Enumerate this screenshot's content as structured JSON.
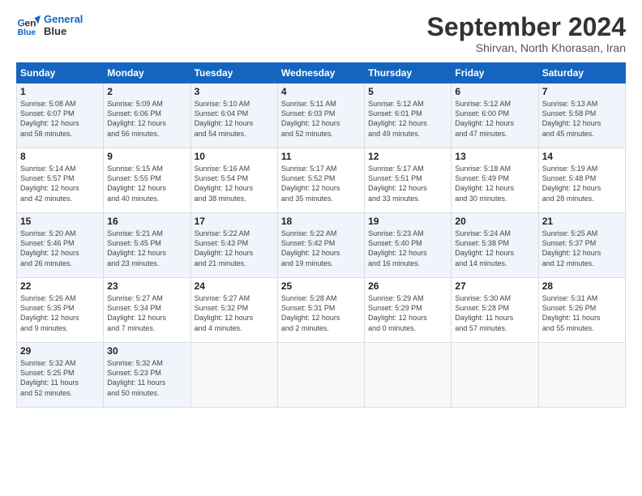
{
  "header": {
    "logo_line1": "General",
    "logo_line2": "Blue",
    "month_title": "September 2024",
    "subtitle": "Shirvan, North Khorasan, Iran"
  },
  "weekdays": [
    "Sunday",
    "Monday",
    "Tuesday",
    "Wednesday",
    "Thursday",
    "Friday",
    "Saturday"
  ],
  "weeks": [
    [
      {
        "day": "1",
        "info": "Sunrise: 5:08 AM\nSunset: 6:07 PM\nDaylight: 12 hours\nand 58 minutes."
      },
      {
        "day": "2",
        "info": "Sunrise: 5:09 AM\nSunset: 6:06 PM\nDaylight: 12 hours\nand 56 minutes."
      },
      {
        "day": "3",
        "info": "Sunrise: 5:10 AM\nSunset: 6:04 PM\nDaylight: 12 hours\nand 54 minutes."
      },
      {
        "day": "4",
        "info": "Sunrise: 5:11 AM\nSunset: 6:03 PM\nDaylight: 12 hours\nand 52 minutes."
      },
      {
        "day": "5",
        "info": "Sunrise: 5:12 AM\nSunset: 6:01 PM\nDaylight: 12 hours\nand 49 minutes."
      },
      {
        "day": "6",
        "info": "Sunrise: 5:12 AM\nSunset: 6:00 PM\nDaylight: 12 hours\nand 47 minutes."
      },
      {
        "day": "7",
        "info": "Sunrise: 5:13 AM\nSunset: 5:58 PM\nDaylight: 12 hours\nand 45 minutes."
      }
    ],
    [
      {
        "day": "8",
        "info": "Sunrise: 5:14 AM\nSunset: 5:57 PM\nDaylight: 12 hours\nand 42 minutes."
      },
      {
        "day": "9",
        "info": "Sunrise: 5:15 AM\nSunset: 5:55 PM\nDaylight: 12 hours\nand 40 minutes."
      },
      {
        "day": "10",
        "info": "Sunrise: 5:16 AM\nSunset: 5:54 PM\nDaylight: 12 hours\nand 38 minutes."
      },
      {
        "day": "11",
        "info": "Sunrise: 5:17 AM\nSunset: 5:52 PM\nDaylight: 12 hours\nand 35 minutes."
      },
      {
        "day": "12",
        "info": "Sunrise: 5:17 AM\nSunset: 5:51 PM\nDaylight: 12 hours\nand 33 minutes."
      },
      {
        "day": "13",
        "info": "Sunrise: 5:18 AM\nSunset: 5:49 PM\nDaylight: 12 hours\nand 30 minutes."
      },
      {
        "day": "14",
        "info": "Sunrise: 5:19 AM\nSunset: 5:48 PM\nDaylight: 12 hours\nand 28 minutes."
      }
    ],
    [
      {
        "day": "15",
        "info": "Sunrise: 5:20 AM\nSunset: 5:46 PM\nDaylight: 12 hours\nand 26 minutes."
      },
      {
        "day": "16",
        "info": "Sunrise: 5:21 AM\nSunset: 5:45 PM\nDaylight: 12 hours\nand 23 minutes."
      },
      {
        "day": "17",
        "info": "Sunrise: 5:22 AM\nSunset: 5:43 PM\nDaylight: 12 hours\nand 21 minutes."
      },
      {
        "day": "18",
        "info": "Sunrise: 5:22 AM\nSunset: 5:42 PM\nDaylight: 12 hours\nand 19 minutes."
      },
      {
        "day": "19",
        "info": "Sunrise: 5:23 AM\nSunset: 5:40 PM\nDaylight: 12 hours\nand 16 minutes."
      },
      {
        "day": "20",
        "info": "Sunrise: 5:24 AM\nSunset: 5:38 PM\nDaylight: 12 hours\nand 14 minutes."
      },
      {
        "day": "21",
        "info": "Sunrise: 5:25 AM\nSunset: 5:37 PM\nDaylight: 12 hours\nand 12 minutes."
      }
    ],
    [
      {
        "day": "22",
        "info": "Sunrise: 5:26 AM\nSunset: 5:35 PM\nDaylight: 12 hours\nand 9 minutes."
      },
      {
        "day": "23",
        "info": "Sunrise: 5:27 AM\nSunset: 5:34 PM\nDaylight: 12 hours\nand 7 minutes."
      },
      {
        "day": "24",
        "info": "Sunrise: 5:27 AM\nSunset: 5:32 PM\nDaylight: 12 hours\nand 4 minutes."
      },
      {
        "day": "25",
        "info": "Sunrise: 5:28 AM\nSunset: 5:31 PM\nDaylight: 12 hours\nand 2 minutes."
      },
      {
        "day": "26",
        "info": "Sunrise: 5:29 AM\nSunset: 5:29 PM\nDaylight: 12 hours\nand 0 minutes."
      },
      {
        "day": "27",
        "info": "Sunrise: 5:30 AM\nSunset: 5:28 PM\nDaylight: 11 hours\nand 57 minutes."
      },
      {
        "day": "28",
        "info": "Sunrise: 5:31 AM\nSunset: 5:26 PM\nDaylight: 11 hours\nand 55 minutes."
      }
    ],
    [
      {
        "day": "29",
        "info": "Sunrise: 5:32 AM\nSunset: 5:25 PM\nDaylight: 11 hours\nand 52 minutes."
      },
      {
        "day": "30",
        "info": "Sunrise: 5:32 AM\nSunset: 5:23 PM\nDaylight: 11 hours\nand 50 minutes."
      },
      {
        "day": "",
        "info": ""
      },
      {
        "day": "",
        "info": ""
      },
      {
        "day": "",
        "info": ""
      },
      {
        "day": "",
        "info": ""
      },
      {
        "day": "",
        "info": ""
      }
    ]
  ]
}
